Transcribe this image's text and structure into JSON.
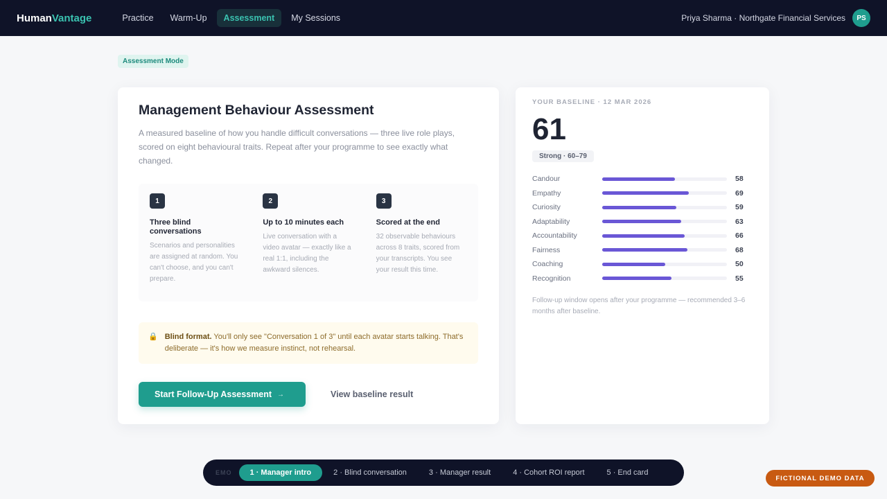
{
  "brand": {
    "part1": "Human",
    "part2": "Vantage",
    "accent_color": "#3ac2b0"
  },
  "nav": {
    "items": [
      {
        "label": "Practice"
      },
      {
        "label": "Warm-Up"
      },
      {
        "label": "Assessment",
        "active": true
      },
      {
        "label": "My Sessions"
      }
    ]
  },
  "user": {
    "label": "Priya Sharma · Northgate Financial Services",
    "initials": "PS"
  },
  "mode_pill": "Assessment Mode",
  "main": {
    "title": "Management Behaviour Assessment",
    "description": "A measured baseline of how you handle difficult conversations — three live role plays, scored on eight behavioural traits. Repeat after your programme to see exactly what changed.",
    "steps": [
      {
        "num": "1",
        "title": "Three blind conversations",
        "text": "Scenarios and personalities are assigned at random. You can't choose, and you can't prepare."
      },
      {
        "num": "2",
        "title": "Up to 10 minutes each",
        "text": "Live conversation with a video avatar — exactly like a real 1:1, including the awkward silences."
      },
      {
        "num": "3",
        "title": "Scored at the end",
        "text": "32 observable behaviours across 8 traits, scored from your transcripts. You see your result this time."
      }
    ],
    "notice": {
      "icon": "lock-icon",
      "bold": "Blind format.",
      "text": " You'll only see \"Conversation 1 of 3\" until each avatar starts talking. That's deliberate — it's how we measure instinct, not rehearsal."
    },
    "primary_button": "Start Follow-Up Assessment",
    "primary_arrow": "→",
    "secondary_link": "View baseline result"
  },
  "baseline": {
    "label": "YOUR BASELINE · 12 MAR 2026",
    "score": "61",
    "band": "Strong · 60–79",
    "traits": [
      {
        "name": "Candour",
        "value": 58
      },
      {
        "name": "Empathy",
        "value": 69
      },
      {
        "name": "Curiosity",
        "value": 59
      },
      {
        "name": "Adaptability",
        "value": 63
      },
      {
        "name": "Accountability",
        "value": 66
      },
      {
        "name": "Fairness",
        "value": 68
      },
      {
        "name": "Coaching",
        "value": 50
      },
      {
        "name": "Recognition",
        "value": 55
      }
    ],
    "note": "Follow-up window opens after your programme — recommended 3–6 months after baseline.",
    "bar_color": "#6a57d6"
  },
  "demo_bar": {
    "tag": "EMO",
    "steps": [
      {
        "label": "1 · Manager intro",
        "active": true
      },
      {
        "label": "2 · Blind conversation"
      },
      {
        "label": "3 · Manager result"
      },
      {
        "label": "4 · Cohort ROI report"
      },
      {
        "label": "5 · End card"
      }
    ]
  },
  "fictional_badge": "FICTIONAL DEMO DATA"
}
